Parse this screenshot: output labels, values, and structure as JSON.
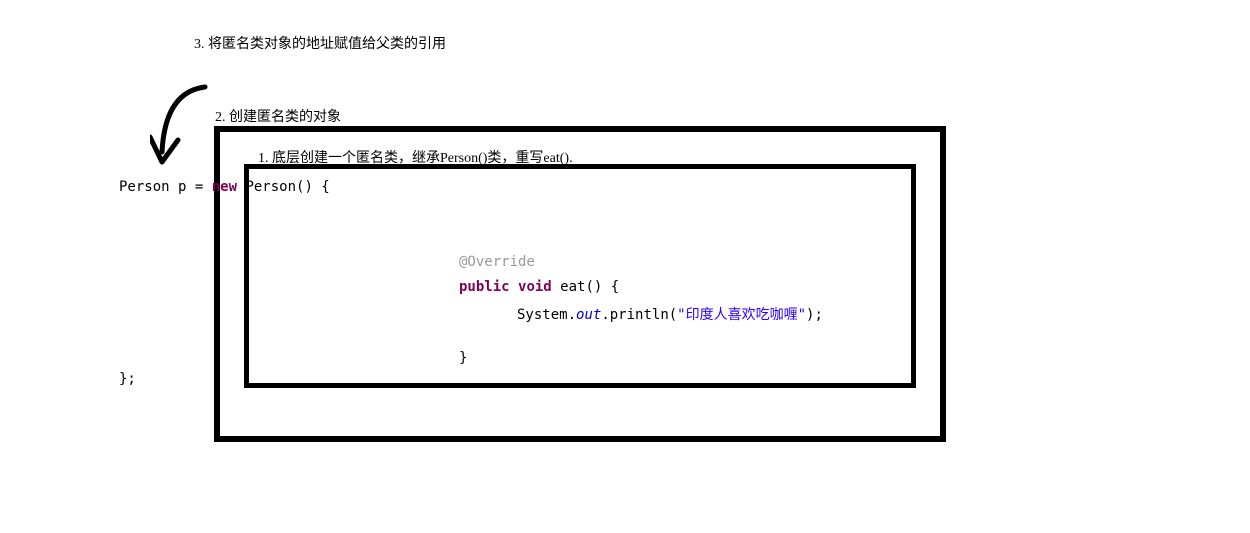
{
  "labels": {
    "step3": "3. 将匿名类对象的地址赋值给父类的引用",
    "step2": "2. 创建匿名类的对象",
    "step1": "1. 底层创建一个匿名类，继承Person()类，重写eat()."
  },
  "code": {
    "declPrefix": "Person p = ",
    "kwNew": "new",
    "declSuffix": " Person() {",
    "override": "@Override",
    "kwPublic": "public",
    "kwVoid": "void",
    "methodSuffix": " eat() {",
    "sysPrefix": "System.",
    "sysField": "out",
    "sysMid": ".println(",
    "stringLit": "\"印度人喜欢吃咖喱\"",
    "callEnd": ");",
    "closeBrace": "}",
    "endSemi": "};"
  }
}
